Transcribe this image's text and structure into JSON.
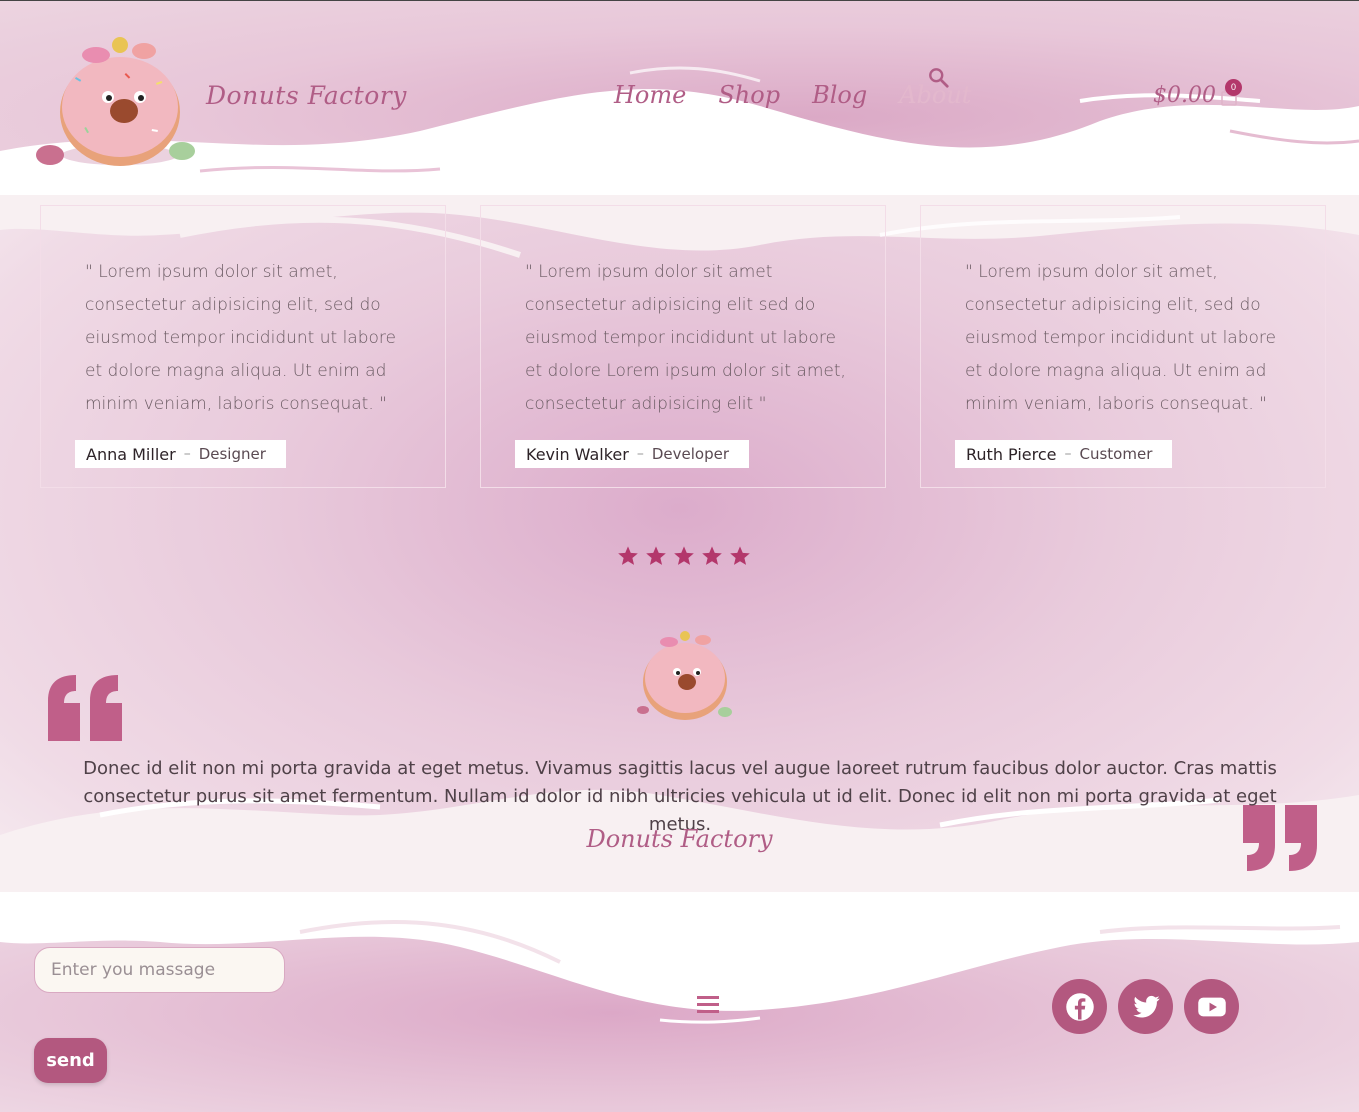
{
  "header": {
    "brand": "Donuts Factory",
    "nav": [
      "Home",
      "Shop",
      "Blog",
      "About"
    ],
    "cart_total": "$0.00",
    "cart_count": "0"
  },
  "testimonials": [
    {
      "quote": "\" Lorem ipsum dolor sit amet, consectetur adipisicing elit, sed do eiusmod tempor incididunt ut labore et dolore magna aliqua. Ut enim ad minim veniam, laboris consequat. \"",
      "name": "Anna Miller",
      "role": "Designer"
    },
    {
      "quote": "\" Lorem ipsum dolor sit amet consectetur adipisicing elit sed do eiusmod tempor incididunt ut labore et dolore Lorem ipsum dolor sit amet, consectetur adipisicing elit \"",
      "name": "Kevin Walker",
      "role": "Developer"
    },
    {
      "quote": "\" Lorem ipsum dolor sit amet, consectetur adipisicing elit, sed do eiusmod tempor incididunt ut labore et dolore magna aliqua. Ut enim ad minim veniam, laboris consequat. \"",
      "name": "Ruth Pierce",
      "role": "Customer"
    }
  ],
  "rating": {
    "stars": 5,
    "color": "#b3376b"
  },
  "feature_quote": {
    "text": "Donec id elit non mi porta gravida at eget metus. Vivamus sagittis lacus vel augue laoreet rutrum faucibus dolor auctor. Cras mattis consectetur purus sit amet fermentum. Nullam id dolor id nibh ultricies vehicula ut id elit. Donec id elit non mi porta gravida at eget metus.",
    "signature": "Donuts Factory"
  },
  "footer": {
    "message_placeholder": "Enter you massage",
    "send_label": "send",
    "social": [
      "facebook-icon",
      "twitter-icon",
      "youtube-icon"
    ]
  },
  "colors": {
    "accent": "#b05d86",
    "button": "#b3587f",
    "star": "#b3376b"
  }
}
